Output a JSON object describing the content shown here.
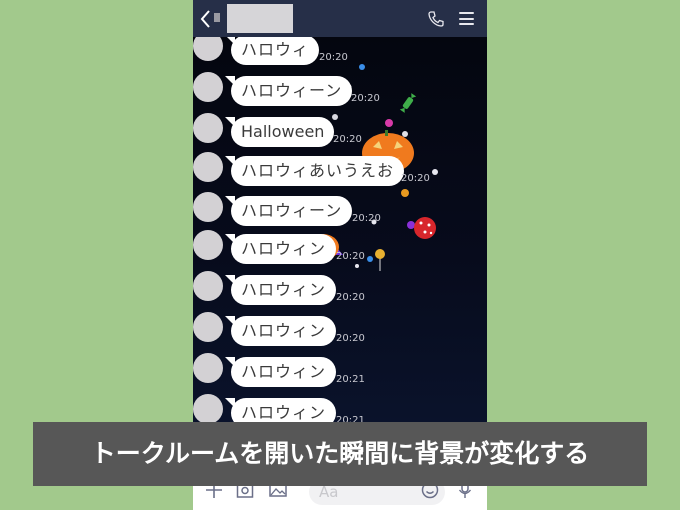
{
  "header": {
    "back_icon": "chevron-left-icon",
    "contact_name": "",
    "call_icon": "phone-icon",
    "menu_icon": "hamburger-menu-icon"
  },
  "messages": [
    {
      "text": "ハロウィ",
      "time": "20:20"
    },
    {
      "text": "ハロウィーン",
      "time": "20:20"
    },
    {
      "text": "Halloween",
      "time": "20:20"
    },
    {
      "text": "ハロウィあいうえお",
      "time": "20:20"
    },
    {
      "text": "ハロウィーン",
      "time": "20:20"
    },
    {
      "text": "ハロウィン",
      "time": "20:20"
    },
    {
      "text": "ハロウィン",
      "time": "20:20"
    },
    {
      "text": "ハロウィン",
      "time": "20:20"
    },
    {
      "text": "ハロウィン",
      "time": "20:21"
    },
    {
      "text": "ハロウィン",
      "time": "20:21"
    }
  ],
  "footer": {
    "add_icon": "plus-icon",
    "camera_icon": "camera-icon",
    "image_icon": "image-icon",
    "input_placeholder": "Aa",
    "emoji_icon": "smiley-icon",
    "mic_icon": "microphone-icon"
  },
  "caption": "トークルームを開いた瞬間に背景が変化する",
  "colors": {
    "page_bg": "#a2c98c",
    "header_bg": "#262f48",
    "chat_bg": "#070b1c",
    "caption_bg": "#575757"
  }
}
